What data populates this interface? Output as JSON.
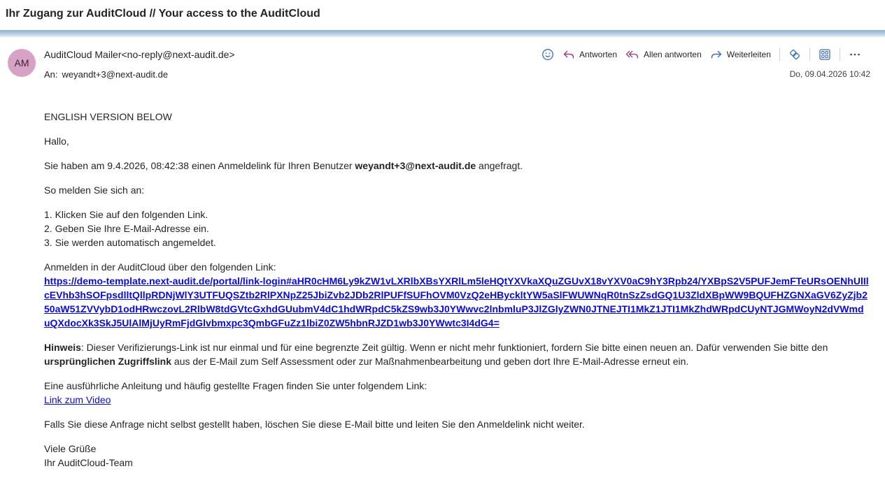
{
  "subject": "Ihr Zugang zur AuditCloud // Your access to the AuditCloud",
  "sender": {
    "initials": "AM",
    "name": "AuditCloud Mailer",
    "email": "<no-reply@next-audit.de>",
    "avatar_color": "#d6a3c6"
  },
  "recipient": {
    "label": "An:",
    "email": "weyandt+3@next-audit.de"
  },
  "toolbar": {
    "reply": "Antworten",
    "reply_all": "Allen antworten",
    "forward": "Weiterleiten"
  },
  "date": "Do, 09.04.2026 10:42",
  "body": {
    "english_note": "ENGLISH VERSION BELOW",
    "greeting": "Hallo,",
    "request_pre": "Sie haben am 9.4.2026, 08:42:38 einen Anmeldelink für Ihren Benutzer ",
    "request_user": "weyandt+3@next-audit.de",
    "request_post": " angefragt.",
    "howto": "So melden Sie sich an:",
    "steps": [
      "1. Klicken Sie auf den folgenden Link.",
      "2. Geben Sie Ihre E-Mail-Adresse ein.",
      "3. Sie werden automatisch angemeldet."
    ],
    "link_intro": "Anmelden in der AuditCloud über den folgenden Link:",
    "login_link": "https://demo-template.next-audit.de/portal/link-login#aHR0cHM6Ly9kZW1vLXRlbXBsYXRlLm5leHQtYXVkaXQuZGUvX18vYXV0aC9hY3Rpb24/YXBpS2V5PUFJemFTeURsOENhUlIlcEVhb3hSOFpsdlltQllpRDNjWlY3UTFUQSZtb2RlPXNpZ25JbiZvb2JDb2RlPUFfSUFhOVM0VzQ2eHByckltYW5aSlFWUWNqR0tnSzZsdGQ1U3ZldXBpWW9BQUFHZGNXaGV6ZyZjb250aW51ZVVybD1odHRwczovL2RlbW8tdGVtcGxhdGUubmV4dC1hdWRpdC5kZS9wb3J0YWwvc2lnbmluP3JlZGlyZWN0JTNEJTI1MkZ1JTI1MkZhdWRpdCUyNTJGMWoyN2dVWmduQXdocXk3SkJ5UlAlMjUyRmFjdGlvbmxpc3QmbGFuZz1lbiZ0ZW5hbnRJZD1wb3J0YWwtc3I4dG4=",
    "hint_label": "Hinweis",
    "hint_text1": ": Dieser Verifizierungs-Link ist nur einmal und für eine begrenzte Zeit gültig. Wenn er nicht mehr funktioniert, fordern Sie bitte einen neuen an. Dafür verwenden Sie bitte den ",
    "hint_bold": "ursprünglichen Zugriffslink",
    "hint_text2": " aus der E-Mail zum Self Assessment oder zur Maßnahmenbearbeitung und geben dort Ihre E-Mail-Adresse erneut ein.",
    "faq_intro": "Eine ausführliche Anleitung und häufig gestellte Fragen finden Sie unter folgendem Link:",
    "video_link": "Link zum Video",
    "not_requested": "Falls Sie diese Anfrage nicht selbst gestellt haben, löschen Sie diese E-Mail bitte und leiten Sie den Anmeldelink nicht weiter.",
    "regards": "Viele Grüße",
    "team": "Ihr AuditCloud-Team"
  }
}
